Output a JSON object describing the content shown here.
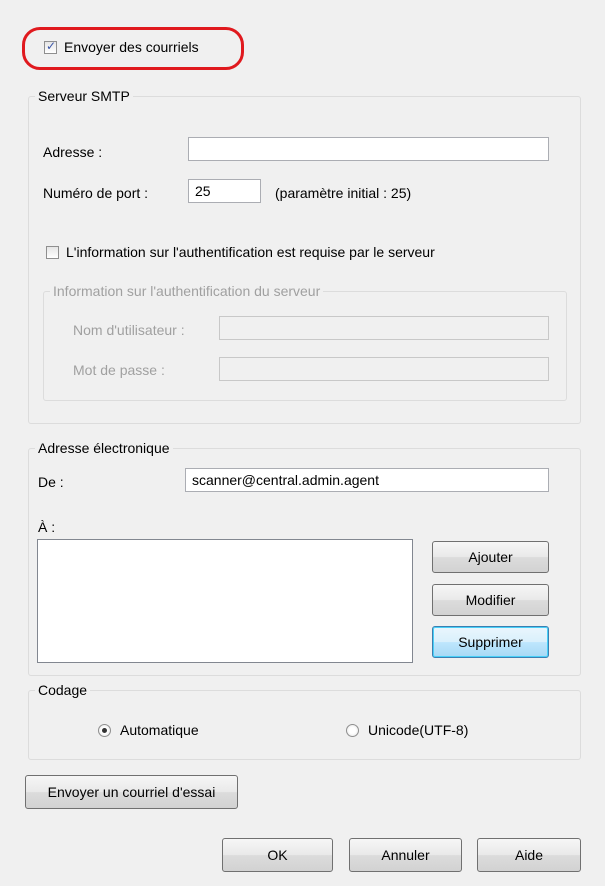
{
  "send_email": {
    "label": "Envoyer des courriels",
    "checked": true
  },
  "smtp": {
    "title": "Serveur SMTP",
    "address_label": "Adresse :",
    "address_value": "",
    "port_label": "Numéro de port :",
    "port_value": "25",
    "port_hint": "(paramètre initial : 25)",
    "auth_required_label": "L'information sur l'authentification est requise par le serveur",
    "auth_required_checked": false,
    "auth": {
      "title": "Information sur l'authentification du serveur",
      "username_label": "Nom d'utilisateur :",
      "username_value": "",
      "password_label": "Mot de passe :",
      "password_value": ""
    }
  },
  "email_address": {
    "title": "Adresse électronique",
    "from_label": "De :",
    "from_value": "scanner@central.admin.agent",
    "to_label": "À :",
    "to_items": [],
    "add_label": "Ajouter",
    "modify_label": "Modifier",
    "delete_label": "Supprimer"
  },
  "encoding": {
    "title": "Codage",
    "options": [
      {
        "label": "Automatique",
        "selected": true
      },
      {
        "label": "Unicode(UTF-8)",
        "selected": false
      }
    ]
  },
  "test_email_label": "Envoyer un courriel d'essai",
  "footer": {
    "ok_label": "OK",
    "cancel_label": "Annuler",
    "help_label": "Aide"
  },
  "colors": {
    "highlight": "#e0191e",
    "background": "#f0f0f0",
    "disabled_text": "#a0a0a0"
  }
}
